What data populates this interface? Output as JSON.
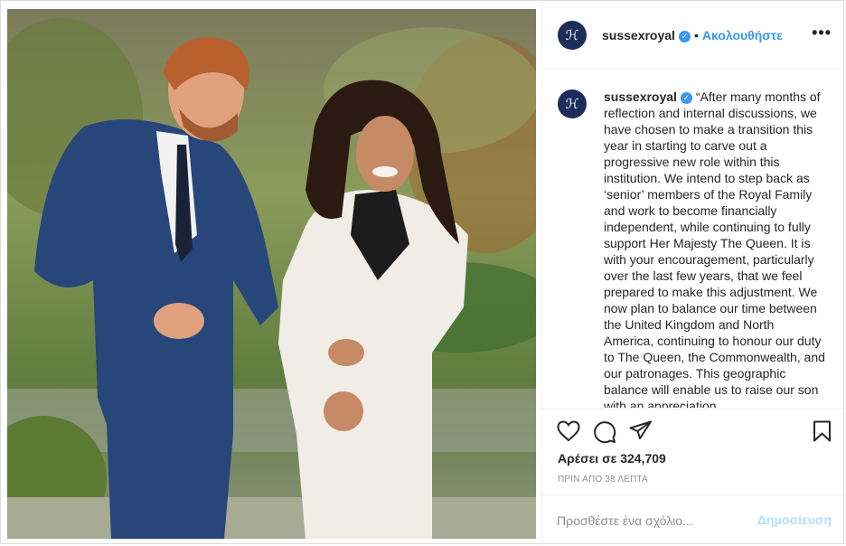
{
  "account": {
    "username": "sussexroyal",
    "avatar_glyph": "ℋ",
    "verified_icon": "verified-badge-icon",
    "follow_label": "Ακολουθήστε",
    "separator": "•",
    "more_icon": "more-options-icon",
    "more_glyph": "•••"
  },
  "caption": {
    "username": "sussexroyal",
    "text": "“After many months of reflection and internal discussions, we have chosen to make a transition this year in starting to carve out a progressive new role within this institution. We intend to step back as ‘senior’ members of the Royal Family and work to become financially independent, while continuing to fully support Her Majesty The Queen. It is with your encouragement, particularly over the last few years, that we feel prepared to make this adjustment. We now plan to balance our time between the United Kingdom and North America, continuing to honour our duty to The Queen, the Commonwealth, and our patronages. This geographic balance will enable us to raise our son with an appreciation"
  },
  "actions": {
    "like_icon": "heart-icon",
    "comment_icon": "comment-icon",
    "share_icon": "send-icon",
    "save_icon": "bookmark-icon",
    "likes_text": "Αρέσει σε 324,709",
    "timestamp": "ΠΡΙΝ ΑΠΟ 38 ΛΕΠΤΑ"
  },
  "comment": {
    "placeholder": "Προσθέστε ένα σχόλιο...",
    "post_label": "Δημοσίευση"
  },
  "colors": {
    "accent": "#3897f0",
    "post_disabled": "#b2dffc",
    "avatar_bg": "#1d2d59"
  }
}
